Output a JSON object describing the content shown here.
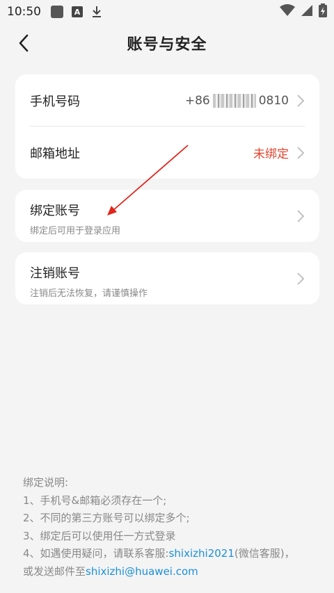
{
  "status_bar": {
    "time": "10:50",
    "icons": [
      "image-square-icon",
      "a-box-icon",
      "download-icon",
      "wifi-icon",
      "signal-icon",
      "battery-charging-icon"
    ]
  },
  "header": {
    "title": "账号与安全",
    "back_icon": "chevron-left-icon"
  },
  "account_card": {
    "phone": {
      "label": "手机号码",
      "prefix": "+86",
      "suffix": "0810"
    },
    "email": {
      "label": "邮箱地址",
      "value": "未绑定"
    }
  },
  "bind_card": {
    "label": "绑定账号",
    "subtitle": "绑定后可用于登录应用"
  },
  "cancel_card": {
    "label": "注销账号",
    "subtitle": "注销后无法恢复，请谨慎操作"
  },
  "notes": {
    "line1": "绑定说明:",
    "line2": "1、手机号&邮箱必须存在一个;",
    "line3": "2、不同的第三方账号可以绑定多个;",
    "line4": "3、绑定后可以使用任一方式登录",
    "line5_prefix": "4、如遇使用疑问，请联系客服:",
    "line5_link": "shixizhi2021",
    "line5_suffix": "(微信客服)，",
    "line6_prefix": "或发送邮件至",
    "line6_link": "shixizhi@huawei.com"
  },
  "colors": {
    "background": "#f4f4f4",
    "card": "#ffffff",
    "unbound_red": "#e0452f",
    "link_blue": "#1a8fd6",
    "annotation_arrow": "#e0261c"
  }
}
